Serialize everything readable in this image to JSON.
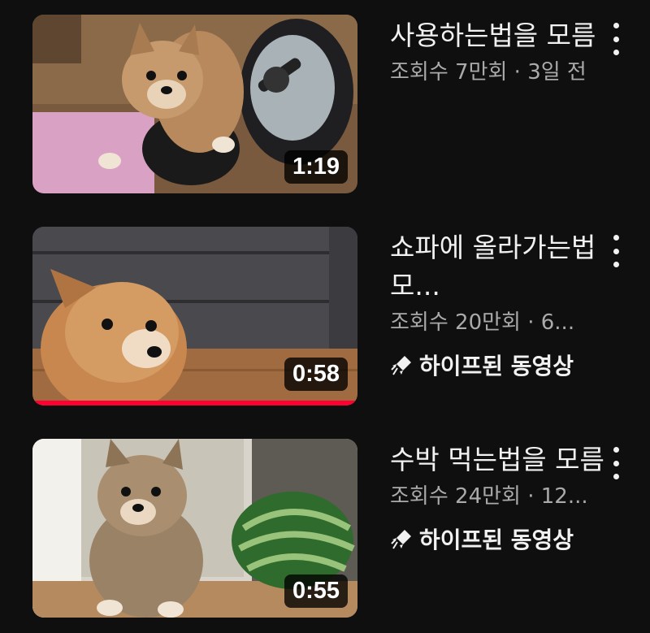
{
  "videos": [
    {
      "title": "사용하는법을 모름",
      "meta": "조회수 7만회 · 3일 전",
      "duration": "1:19",
      "badge": ""
    },
    {
      "title": "쇼파에 올라가는법 모...",
      "meta": "조회수 20만회 · 6...",
      "duration": "0:58",
      "badge": "하이프된 동영상",
      "watched_fraction": 1.0
    },
    {
      "title": "수박 먹는법을 모름",
      "meta": "조회수 24만회 · 12...",
      "duration": "0:55",
      "badge": "하이프된 동영상"
    }
  ],
  "colors": {
    "background": "#0f0f0f",
    "progress": "#ff0033",
    "secondary_text": "#aaaaaa"
  }
}
